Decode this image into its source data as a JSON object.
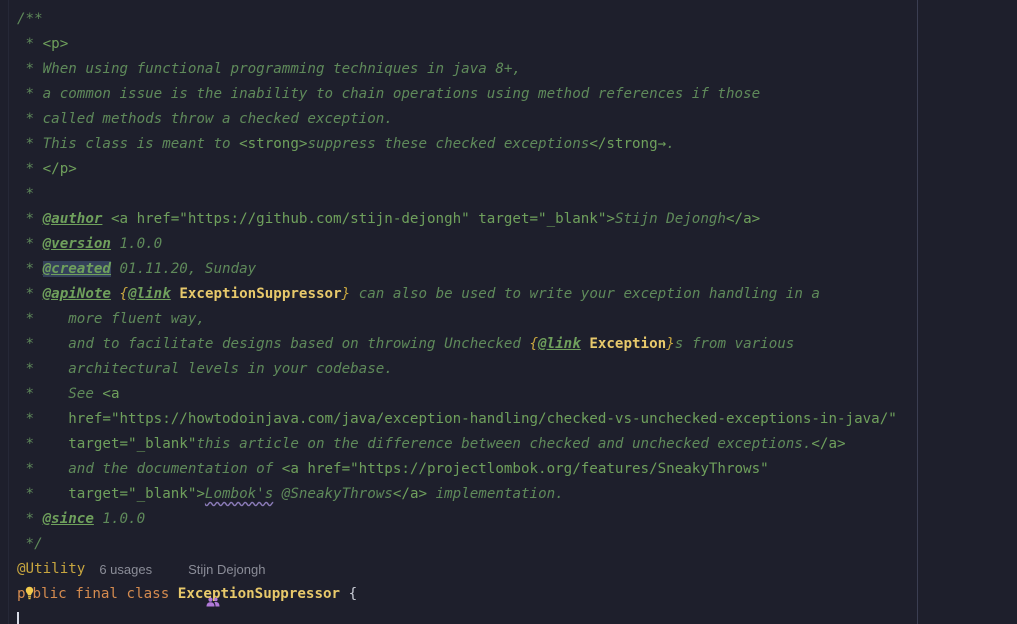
{
  "doc_comment": {
    "open": "/**",
    "close": " */",
    "star": " * ",
    "star_blank": " *",
    "continuation": " *    ",
    "p_open": "<p>",
    "p_close": "</p>",
    "l1": "When using functional programming techniques in java 8+,",
    "l2": "a common issue is the inability to chain operations using method references if those",
    "l3": "called methods throw a checked exception.",
    "l4_pre": "This class is meant to ",
    "strong_open": "<strong>",
    "l4_strong": "suppress these checked exceptions",
    "strong_close": "</strong",
    "arrow": "→",
    "l4_post": ".",
    "author": {
      "tag": "@author",
      "a_open": "<a href=\"https://github.com/stijn-dejongh\" target=\"_blank\">",
      "name": "Stijn Dejongh",
      "a_close": "</a>"
    },
    "version": {
      "tag": "@version",
      "value": "1.0.0"
    },
    "created": {
      "tag": "@created",
      "value": "01.11.20, Sunday"
    },
    "apinote": {
      "tag": "@apiNote",
      "brace_open": "{",
      "link_tag": "@link",
      "link_target": "ExceptionSuppressor",
      "brace_close": "}",
      "rest1": " can also be used to write your exception handling in a",
      "l2": "more fluent way,",
      "l3_pre": "and to facilitate designs based on throwing Unchecked ",
      "l3_link_target": "Exception",
      "l3_post": "s from various",
      "l4": "architectural levels in your codebase.",
      "l5_pre": "See ",
      "l5_tag": "<a",
      "l6_href": "href=\"https://howtodoinjava.com/java/exception-handling/checked-vs-unchecked-exceptions-in-java/\"",
      "l7_target": "target=\"_blank\"",
      "l7_text": "this article on the difference between checked and unchecked exceptions.",
      "l7_close": "</a>",
      "l8_pre": "and the documentation of ",
      "l8_a": "<a href=\"https://projectlombok.org/features/SneakyThrows\"",
      "l9_target": "target=\"_blank\">",
      "l9_lombok": "Lombok's",
      "l9_sneaky": " @SneakyThrows",
      "l9_close": "</a>",
      "l9_post": " implementation."
    },
    "since": {
      "tag": "@since",
      "value": "1.0.0"
    }
  },
  "annotation": "@Utility",
  "hints": {
    "usages": "6 usages",
    "author": "Stijn Dejongh"
  },
  "declaration": {
    "kw_public_a": "p",
    "kw_public_b": "blic",
    "kw_final": "final",
    "kw_class": "class",
    "class_name": "ExceptionSuppressor",
    "brace": "{"
  },
  "icons": {
    "hint_author": "people-icon",
    "intention": "lightbulb-icon"
  },
  "colors": {
    "background": "#1e1f2c",
    "comment": "#5f8a5a",
    "doc_tag": "#6fa05c",
    "keyword": "#d58b4f",
    "class_name": "#e8c96b",
    "annotation": "#c8a63f",
    "hint": "#8b8d98"
  }
}
